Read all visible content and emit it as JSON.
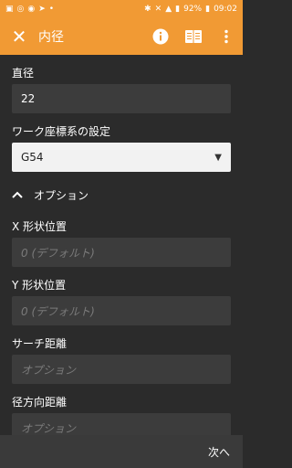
{
  "status": {
    "battery": "92%",
    "time": "09:02"
  },
  "app_bar": {
    "title": "内径"
  },
  "form": {
    "diameter_label": "直径",
    "diameter_value": "22",
    "work_coord_label": "ワーク座標系の設定",
    "work_coord_value": "G54",
    "options_title": "オプション",
    "x_pos_label": "X 形状位置",
    "x_pos_placeholder": "0 (デフォルト)",
    "y_pos_label": "Y 形状位置",
    "y_pos_placeholder": "0 (デフォルト)",
    "search_dist_label": "サーチ距離",
    "search_dist_placeholder": "オプション",
    "radial_dist_label": "径方向距離",
    "radial_dist_placeholder": "オプション"
  },
  "bottom": {
    "next_label": "次へ"
  },
  "colors": {
    "accent": "#f19a34",
    "background": "#2b2b2b",
    "field": "#3c3c3c"
  }
}
